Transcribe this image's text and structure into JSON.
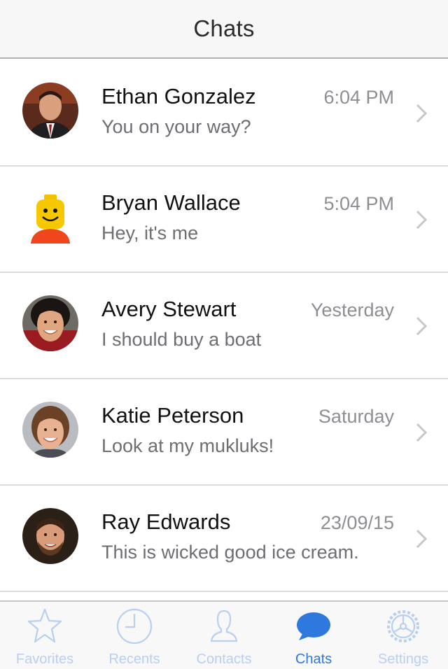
{
  "navbar": {
    "title": "Chats"
  },
  "chats": [
    {
      "name": "Ethan Gonzalez",
      "time": "6:04 PM",
      "message": "You on your way?",
      "avatar": "ethan-avatar"
    },
    {
      "name": "Bryan Wallace",
      "time": "5:04 PM",
      "message": "Hey, it's me",
      "avatar": "lego-avatar"
    },
    {
      "name": "Avery Stewart",
      "time": "Yesterday",
      "message": "I should buy a boat",
      "avatar": "avery-avatar"
    },
    {
      "name": "Katie Peterson",
      "time": "Saturday",
      "message": "Look at my mukluks!",
      "avatar": "katie-avatar"
    },
    {
      "name": "Ray Edwards",
      "time": "23/09/15",
      "message": "This is wicked good ice cream.",
      "avatar": "ray-avatar"
    }
  ],
  "tabs": [
    {
      "label": "Favorites",
      "icon": "star-icon",
      "active": false
    },
    {
      "label": "Recents",
      "icon": "clock-icon",
      "active": false
    },
    {
      "label": "Contacts",
      "icon": "person-icon",
      "active": false
    },
    {
      "label": "Chats",
      "icon": "chat-bubble-icon",
      "active": true
    },
    {
      "label": "Settings",
      "icon": "gear-icon",
      "active": false
    }
  ],
  "colors": {
    "accent": "#2f79de",
    "inactive_tab": "#b8cff2",
    "secondary_text": "#8e8e93"
  }
}
